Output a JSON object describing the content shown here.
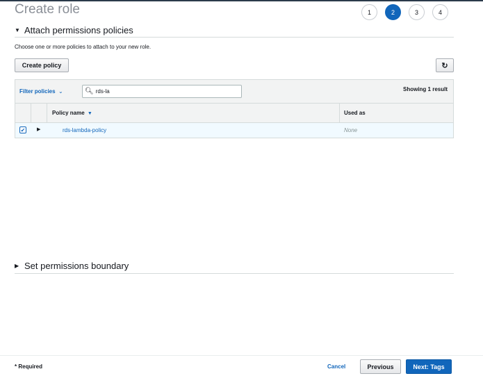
{
  "page": {
    "title": "Create role",
    "steps": [
      "1",
      "2",
      "3",
      "4"
    ],
    "active_step": "2"
  },
  "attach_section": {
    "title": "Attach permissions policies",
    "description": "Choose one or more policies to attach to your new role.",
    "create_policy_label": "Create policy",
    "refresh_icon": "refresh-icon"
  },
  "table": {
    "filter_label": "Filter policies",
    "search": {
      "value": "rds-la",
      "placeholder": ""
    },
    "result_count": "Showing 1 result",
    "columns": [
      "Policy name",
      "Used as"
    ],
    "rows": [
      {
        "policy_name": "rds-lambda-policy",
        "used_as": "None",
        "checked": true
      }
    ]
  },
  "boundary_section": {
    "title": "Set permissions boundary"
  },
  "footer": {
    "required_note": "* Required",
    "cancel_label": "Cancel",
    "previous_label": "Previous",
    "next_label": "Next: Tags"
  },
  "colors": {
    "accent": "#1166bb",
    "border": "#d5dbdb",
    "header_bg": "#f2f3f3",
    "selected_row_bg": "#f1faff"
  }
}
